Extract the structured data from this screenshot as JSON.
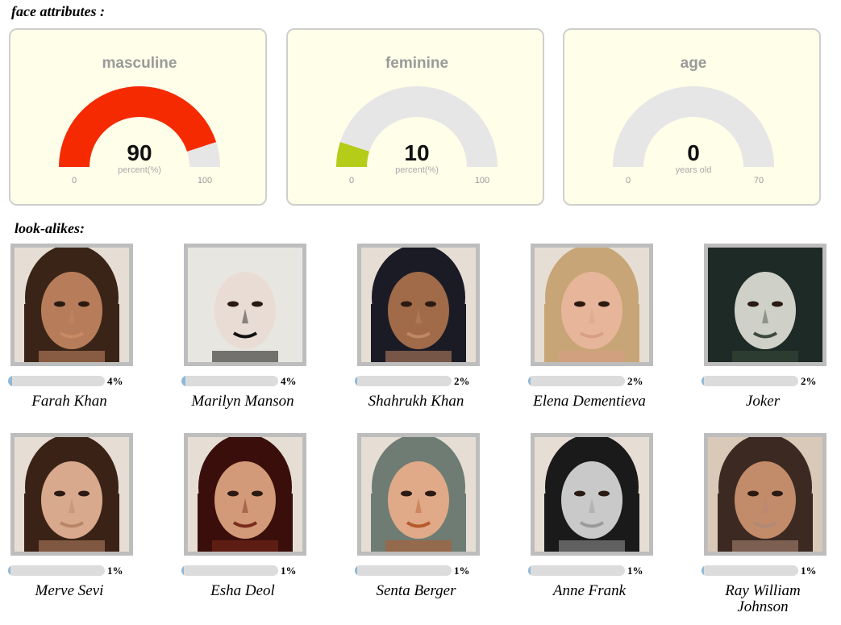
{
  "headings": {
    "face_attributes": "face attributes :",
    "look_alikes": "look-alikes:"
  },
  "gauges": [
    {
      "title": "masculine",
      "value": 90,
      "unit": "percent(%)",
      "min": 0,
      "max": 100,
      "color": "#f62a00"
    },
    {
      "title": "feminine",
      "value": 10,
      "unit": "percent(%)",
      "min": 0,
      "max": 100,
      "color": "#b5cc18"
    },
    {
      "title": "age",
      "value": 0,
      "unit": "years old",
      "min": 0,
      "max": 70,
      "color": "#e6e6e6"
    }
  ],
  "lookalikes": [
    {
      "name": "Farah Khan",
      "percent": "4%",
      "value": 4,
      "tones": [
        "#3a2417",
        "#b77d5a",
        "#c98a66"
      ]
    },
    {
      "name": "Marilyn Manson",
      "percent": "4%",
      "value": 4,
      "tones": [
        "#e8e6e0",
        "#e9dcd4",
        "#111111"
      ]
    },
    {
      "name": "Shahrukh Khan",
      "percent": "2%",
      "value": 2,
      "tones": [
        "#1b1b26",
        "#a16a48",
        "#bf8763"
      ]
    },
    {
      "name": "Elena Dementieva",
      "percent": "2%",
      "value": 2,
      "tones": [
        "#c7a576",
        "#e6b59a",
        "#d99f86"
      ]
    },
    {
      "name": "Joker",
      "percent": "2%",
      "value": 2,
      "tones": [
        "#1d2a26",
        "#cfd1c8",
        "#3b4a3a"
      ]
    },
    {
      "name": "Merve Sevi",
      "percent": "1%",
      "value": 1,
      "tones": [
        "#3a2216",
        "#d8a98d",
        "#b98568"
      ]
    },
    {
      "name": "Esha Deol",
      "percent": "1%",
      "value": 1,
      "tones": [
        "#3a0f0b",
        "#d29a79",
        "#7b2a1c"
      ]
    },
    {
      "name": "Senta Berger",
      "percent": "1%",
      "value": 1,
      "tones": [
        "#6e7c73",
        "#e0a987",
        "#b65a2a"
      ]
    },
    {
      "name": "Anne Frank",
      "percent": "1%",
      "value": 1,
      "tones": [
        "#1a1a1a",
        "#c9c9c9",
        "#9a9a9a"
      ]
    },
    {
      "name": "Ray William\nJohnson",
      "percent": "1%",
      "value": 1,
      "tones": [
        "#3c2a22",
        "#c28b6a",
        "#b08a76"
      ]
    }
  ]
}
